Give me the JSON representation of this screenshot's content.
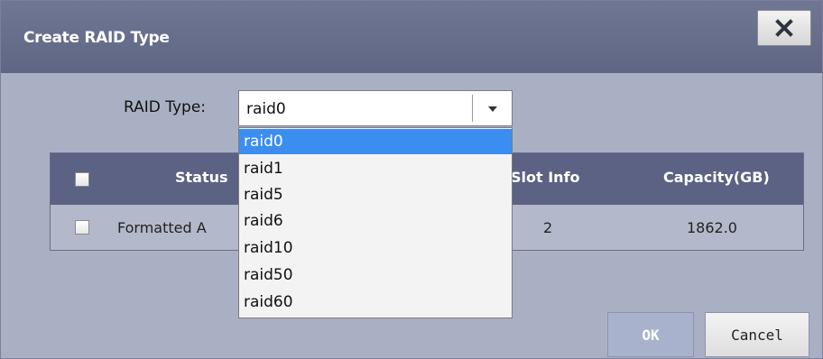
{
  "dialog": {
    "title": "Create RAID Type",
    "close_icon": "close-x-icon"
  },
  "raid_type": {
    "label": "RAID Type:",
    "selected": "raid0",
    "arrow_icon": "chevron-down-icon",
    "options": [
      "raid0",
      "raid1",
      "raid5",
      "raid6",
      "raid10",
      "raid50",
      "raid60"
    ]
  },
  "table": {
    "headers": {
      "status": "Status",
      "slot_info": "Slot Info",
      "capacity": "Capacity(GB)"
    },
    "rows": [
      {
        "status": "Formatted A",
        "slot": "2",
        "capacity": "1862.0"
      }
    ]
  },
  "buttons": {
    "ok": "OK",
    "cancel": "Cancel"
  },
  "colors": {
    "titlebar": "#6f7794",
    "dialog_body": "#aab0c4",
    "table_header": "#5b6283",
    "selected_option": "#3b8ef0"
  }
}
